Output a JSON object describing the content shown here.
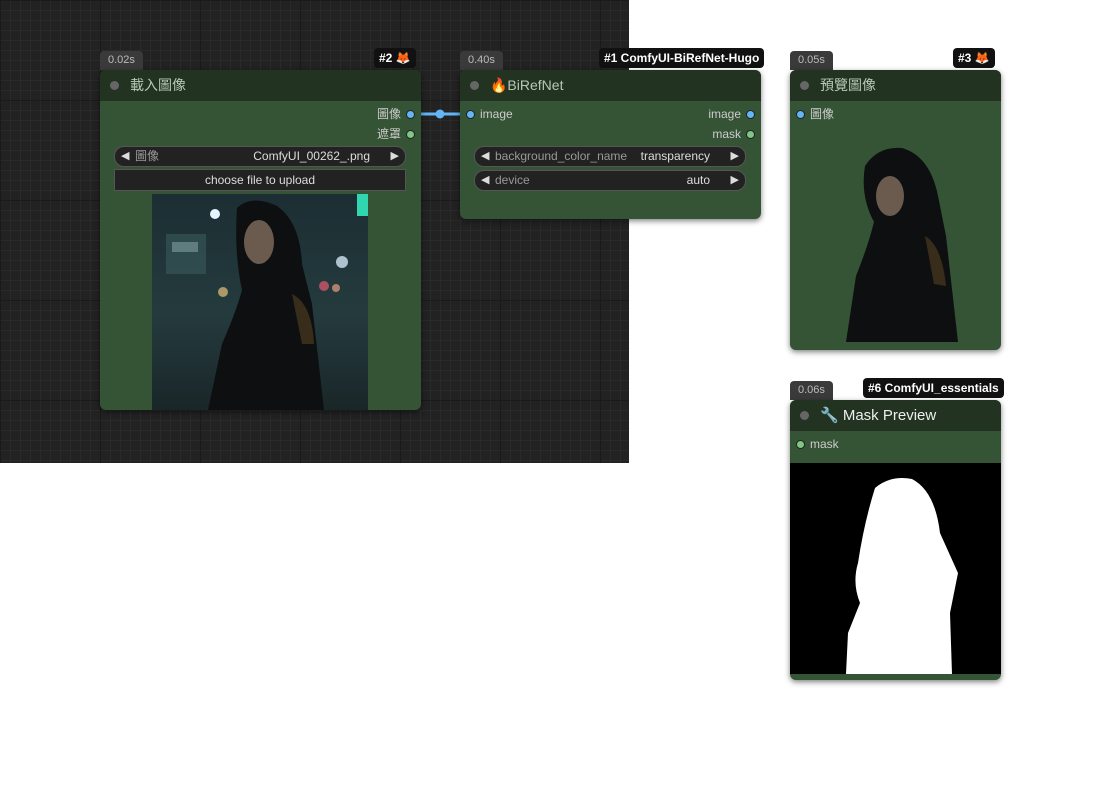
{
  "canvas": {
    "links": [
      {
        "from": "load-image.image",
        "to": "birefnet.image",
        "color": "#64b5f6"
      }
    ]
  },
  "nodes": {
    "load_image": {
      "time": "0.02s",
      "badge": "#2 🦊",
      "title": "載入圖像",
      "outputs": [
        "圖像",
        "遮罩"
      ],
      "image_widget": {
        "label": "圖像",
        "value": "ComfyUI_00262_.png"
      },
      "upload_button": "choose file to upload"
    },
    "birefnet": {
      "time": "0.40s",
      "badge": "#1 ComfyUI-BiRefNet-Hugo",
      "title": "🔥BiRefNet",
      "inputs": [
        "image"
      ],
      "outputs": [
        "image",
        "mask"
      ],
      "widgets": [
        {
          "label": "background_color_name",
          "value": "transparency"
        },
        {
          "label": "device",
          "value": "auto"
        }
      ]
    },
    "preview_image": {
      "time": "0.05s",
      "badge": "#3 🦊",
      "title": "預覽圖像",
      "inputs": [
        "圖像"
      ]
    },
    "mask_preview": {
      "time": "0.06s",
      "badge": "#6 ComfyUI_essentials",
      "title": "🔧 Mask Preview",
      "inputs": [
        "mask"
      ]
    }
  },
  "colors": {
    "node_bg": "#355335",
    "title_bg": "#223322",
    "image_slot": "#64b5f6",
    "mask_slot": "#81c784"
  }
}
